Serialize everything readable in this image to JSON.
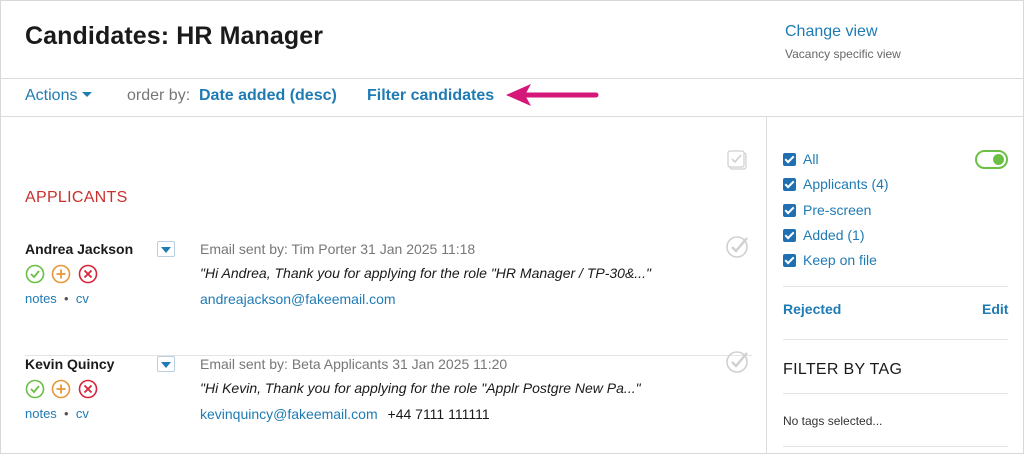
{
  "header": {
    "title": "Candidates: HR Manager",
    "change_view_label": "Change view",
    "change_view_sub": "Vacancy specific view"
  },
  "toolbar": {
    "actions_label": "Actions",
    "order_by_label": "order by:",
    "order_by_value": "Date added (desc)",
    "filter_label": "Filter candidates"
  },
  "main": {
    "section_title": "APPLICANTS",
    "candidates": [
      {
        "name": "Andrea Jackson",
        "notes_label": "notes",
        "cv_label": "cv",
        "email_sent": "Email sent by: Tim Porter 31 Jan 2025 11:18",
        "quote": "\"Hi Andrea, Thank you for applying for the role \"HR Manager / TP-30&...\"",
        "email": "andreajackson@fakeemail.com",
        "phone": ""
      },
      {
        "name": "Kevin Quincy",
        "notes_label": "notes",
        "cv_label": "cv",
        "email_sent": "Email sent by: Beta Applicants 31 Jan 2025 11:20",
        "quote": "\"Hi Kevin, Thank you for applying for the role \"Applr Postgre New Pa...\"",
        "email": "kevinquincy@fakeemail.com",
        "phone": "+44 7111 111111"
      }
    ]
  },
  "sidebar": {
    "filters": [
      {
        "label": "All",
        "checked": true
      },
      {
        "label": "Applicants (4)",
        "checked": true
      },
      {
        "label": "Pre-screen",
        "checked": true
      },
      {
        "label": "Added (1)",
        "checked": true
      },
      {
        "label": "Keep on file",
        "checked": true
      }
    ],
    "rejected_label": "Rejected",
    "edit_label": "Edit",
    "tag_title": "FILTER BY TAG",
    "no_tags": "No tags selected..."
  },
  "colors": {
    "link": "#1f7bb3",
    "section_title": "#c9302c",
    "arrow": "#d6177a",
    "toggle": "#6bbf45",
    "status_accept": "#6bbf45",
    "status_maybe": "#e8963a",
    "status_reject": "#d8253c"
  },
  "icons": [
    "chevron-down-icon",
    "accept-icon",
    "maybe-icon",
    "reject-icon",
    "checkmark-icon",
    "select-all-checkbox-icon",
    "arrow-icon"
  ]
}
